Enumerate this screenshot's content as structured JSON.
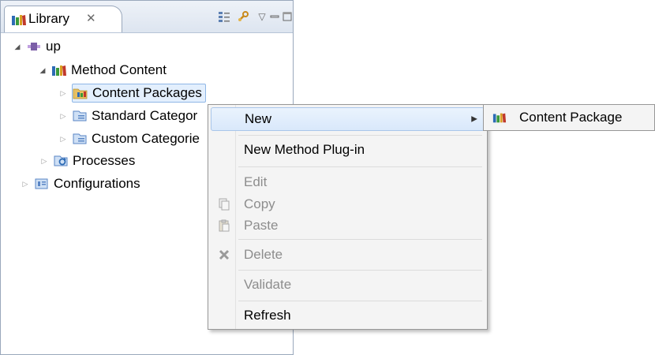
{
  "panel": {
    "tab_title": "Library",
    "tab_close": "✕"
  },
  "tree": {
    "root": "up",
    "method_content": "Method Content",
    "content_packages": "Content Packages",
    "standard_categories": "Standard Categor",
    "custom_categories": "Custom Categorie",
    "processes": "Processes",
    "configurations": "Configurations"
  },
  "menu": {
    "new": "New",
    "new_plugin": "New Method Plug-in",
    "edit": "Edit",
    "copy": "Copy",
    "paste": "Paste",
    "delete": "Delete",
    "validate": "Validate",
    "refresh": "Refresh"
  },
  "submenu": {
    "content_package": "Content Package"
  },
  "colors": {
    "selection_bg": "#e3effd",
    "selection_border": "#8fb7e6",
    "menu_bg": "#f4f4f4",
    "disabled_text": "#8d8d8d"
  }
}
